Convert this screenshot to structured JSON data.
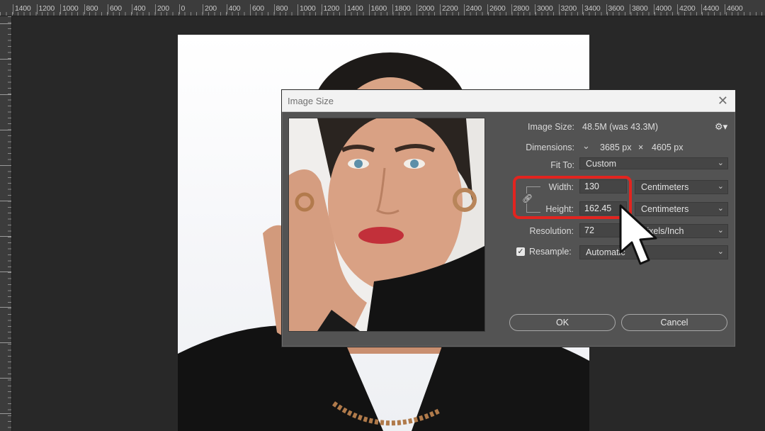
{
  "ruler": {
    "top_labels": [
      "1400",
      "1200",
      "1000",
      "800",
      "600",
      "400",
      "200",
      "0",
      "200",
      "400",
      "600",
      "800",
      "1000",
      "1200",
      "1400",
      "1600",
      "1800",
      "2000",
      "2200",
      "2400",
      "2600",
      "2800",
      "3000",
      "3200",
      "3400",
      "3600",
      "3800",
      "4000",
      "4200",
      "4400",
      "4600"
    ]
  },
  "dialog": {
    "title": "Image Size",
    "close_glyph": "✕",
    "image_size_label": "Image Size:",
    "image_size_value": "48.5M (was 43.3M)",
    "dimensions_label": "Dimensions:",
    "dimensions_width": "3685 px",
    "dimensions_x": "×",
    "dimensions_height": "4605 px",
    "fit_to_label": "Fit To:",
    "fit_to_value": "Custom",
    "width_label": "Width:",
    "width_value": "130",
    "width_unit": "Centimeters",
    "height_label": "Height:",
    "height_value": "162.45",
    "height_unit": "Centimeters",
    "resolution_label": "Resolution:",
    "resolution_value": "72",
    "resolution_unit": "Pixels/Inch",
    "resample_label": "Resample:",
    "resample_checked": true,
    "resample_value": "Automatic",
    "ok_label": "OK",
    "cancel_label": "Cancel",
    "highlight_color": "#e2241f"
  },
  "icons": {
    "gear": "gear-icon",
    "link": "link-icon",
    "chevron": "chevron-down-icon",
    "cursor": "mouse-pointer-icon"
  }
}
